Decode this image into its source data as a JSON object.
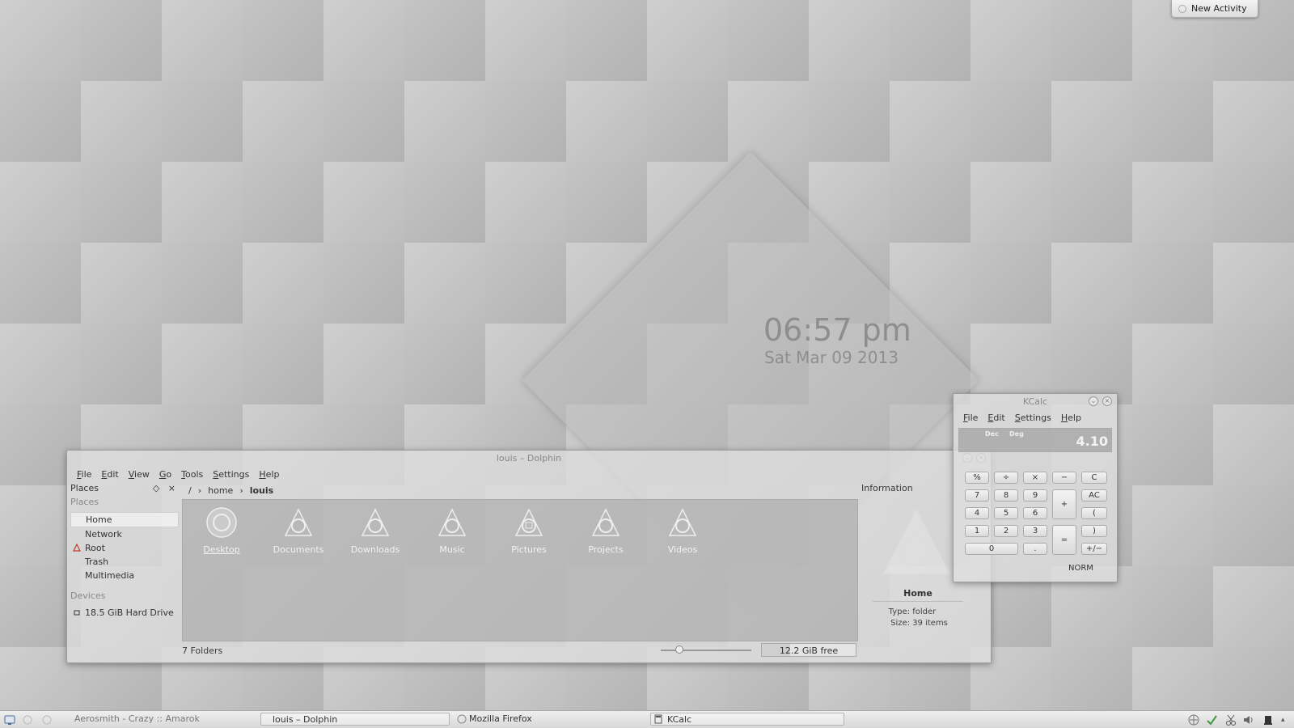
{
  "desktop": {
    "activity_button": "New Activity",
    "clock": {
      "time": "06:57 pm",
      "date": "Sat Mar 09 2013"
    }
  },
  "dolphin": {
    "title": "louis – Dolphin",
    "menu": [
      "File",
      "Edit",
      "View",
      "Go",
      "Tools",
      "Settings",
      "Help"
    ],
    "places_panel_title": "Places",
    "places_header": "Places",
    "places": [
      "Home",
      "Network",
      "Root",
      "Trash",
      "Multimedia"
    ],
    "devices_header": "Devices",
    "devices": [
      "18.5 GiB Hard Drive"
    ],
    "breadcrumb": {
      "root": "/",
      "home": "home",
      "current": "louis"
    },
    "files": [
      "Desktop",
      "Documents",
      "Downloads",
      "Music",
      "Pictures",
      "Projects",
      "Videos"
    ],
    "status_text": "7 Folders",
    "free_space": "12.2 GiB free",
    "info_panel": {
      "title": "Information",
      "name": "Home",
      "type_label": "Type:",
      "type_value": "folder",
      "size_label": "Size:",
      "size_value": "39 items"
    }
  },
  "kcalc": {
    "title": "KCalc",
    "menu": [
      "File",
      "Edit",
      "Settings",
      "Help"
    ],
    "display": {
      "base": "Dec",
      "angle": "Deg",
      "value": "4.10"
    },
    "keys": {
      "percent": "%",
      "divide": "÷",
      "multiply": "×",
      "minus": "−",
      "clear": "C",
      "seven": "7",
      "eight": "8",
      "nine": "9",
      "plus": "+",
      "all_clear": "AC",
      "four": "4",
      "five": "5",
      "six": "6",
      "open_paren": "(",
      "one": "1",
      "two": "2",
      "three": "3",
      "equals": "=",
      "close_paren": ")",
      "zero": "0",
      "dot": ".",
      "plus_minus": "+/−"
    },
    "mode": "NORM"
  },
  "taskbar": {
    "items": [
      {
        "label": "Aerosmith - Crazy  ::  Amarok",
        "active": false
      },
      {
        "label": "louis – Dolphin",
        "active": true
      },
      {
        "label": "Mozilla Firefox",
        "active": false
      },
      {
        "label": "KCalc",
        "active": true
      }
    ]
  }
}
